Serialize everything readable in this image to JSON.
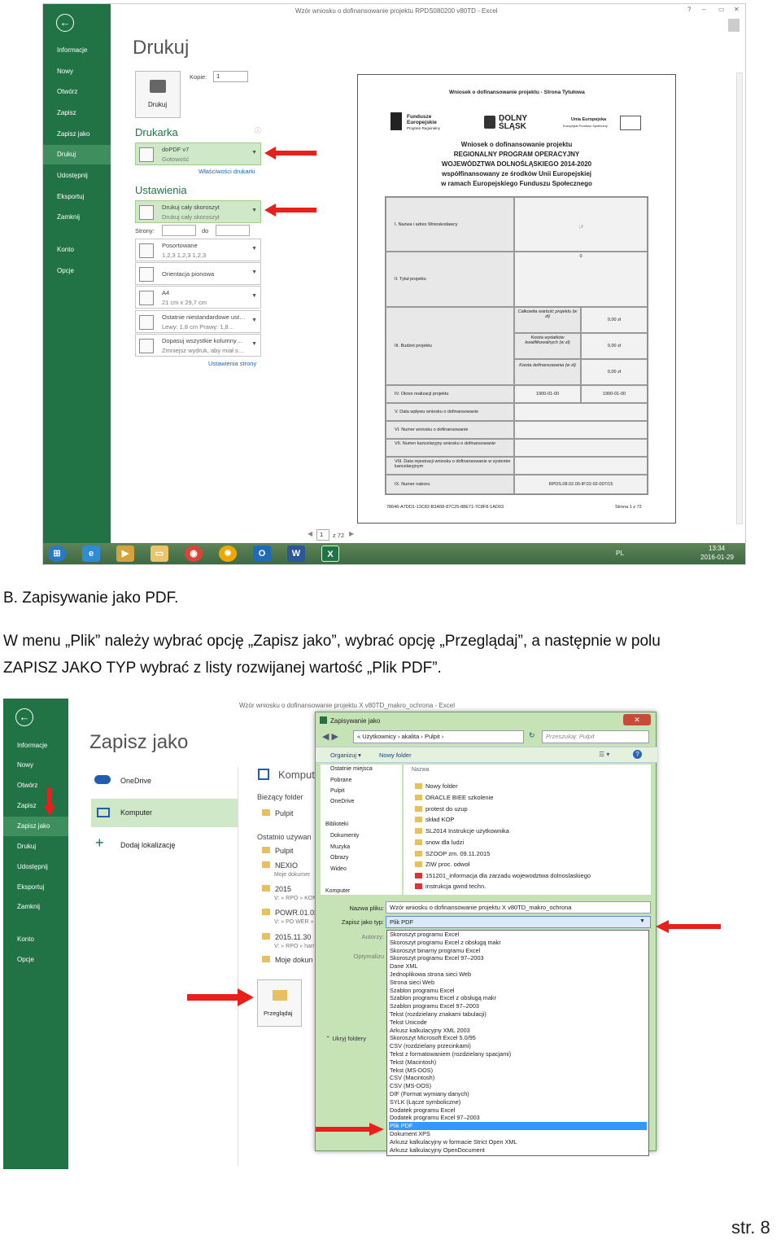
{
  "shot1": {
    "window_title": "Wzór wniosku o dofinansowanie projektu RPDS080200 v80TD - Excel",
    "window_controls": [
      "?",
      "–",
      "▭",
      "✕"
    ],
    "back_symbol": "←",
    "menu": [
      "Informacje",
      "Nowy",
      "Otwórz",
      "Zapisz",
      "Zapisz jako",
      "Drukuj",
      "Udostępnij",
      "Eksportuj",
      "Zamknij",
      "Konto",
      "Opcje"
    ],
    "heading": "Drukuj",
    "copies_label": "Kopie:",
    "copies_value": "1",
    "print_button": "Drukuj",
    "printer_section": "Drukarka",
    "printer_name": "doPDF v7",
    "printer_status": "Gotowość",
    "printer_properties": "Właściwości drukarki",
    "settings_section": "Ustawienia",
    "settings": [
      {
        "l1": "Drukuj cały skoroszyt",
        "l2": "Drukuj cały skoroszyt"
      },
      {
        "l1": "Posortowane",
        "l2": "1,2,3    1,2,3    1,2,3"
      },
      {
        "l1": "Orientacja pionowa",
        "l2": ""
      },
      {
        "l1": "A4",
        "l2": "21  cm x 29,7  cm"
      },
      {
        "l1": "Ostatnie niestandardowe ust…",
        "l2": "Lewy:  1,8  cm    Prawy:  1,8…"
      },
      {
        "l1": "Dopasuj wszystkie kolumny…",
        "l2": "Zmniejsz wydruk, aby miał s…"
      }
    ],
    "pages_label": "Strony:",
    "pages_to": "do",
    "page_setup_link": "Ustawienia strony",
    "pager_current": "1",
    "pager_total": "z 72",
    "taskbar_time": "13:34",
    "taskbar_date": "2016-01-29",
    "taskbar_lang": "PL",
    "preview": {
      "title": "Wniosek o dofinansowanie projektu - Strona Tytułowa",
      "logo_left_1": "Fundusze",
      "logo_left_2": "Europejskie",
      "logo_left_3": "Program Regionalny",
      "logo_mid_1": "DOLNY",
      "logo_mid_2": "ŚLĄSK",
      "logo_right_1": "Unia Europejska",
      "logo_right_2": "Europejski Fundusz Społeczny",
      "head_lines": [
        "Wniosek o dofinansowanie projektu",
        "REGIONALNY PROGRAM OPERACYJNY",
        "WOJEWÓDZTWA DOLNOŚLĄSKIEGO 2014-2020",
        "współfinansowany ze środków Unii Europejskiej",
        "w ramach Europejskiego Funduszu Społecznego"
      ],
      "row1_label": "I.    Nazwa i adres Wnioskodawcy",
      "row1_value": ";  /",
      "row2_label": "II. Tytuł projektu",
      "row2_value": "0",
      "row3_label": "III.   Budżet projektu",
      "budget": [
        {
          "k": "Całkowita wartość projektu (w zł)",
          "v": "0,00 zł"
        },
        {
          "k": "Kwota wydatków kwalifikowalnych (w zł)",
          "v": "0,00 zł"
        },
        {
          "k": "Kwota dofinansowania (w zł)",
          "v": "0,00 zł"
        }
      ],
      "row4_label": "IV. Okres realizacji projektu",
      "row4_from": "1900-01-00",
      "row4_to": "1900-01-00",
      "row5_label": "V. Data wpływu wniosku o dofinansowanie",
      "row6_label": "VI. Numer wniosku o dofinansowanie",
      "row7_label": "VII.   Numer kancelaryjny wniosku o dofinansowanie",
      "row8_label": "VIII. Data rejestracji wniosku o dofinansowanie w systemie kancelaryjnym",
      "row9_label": "IX. Numer naboru",
      "row9_value": "RPDS.08.02.00-IP.02-02-007/15",
      "footer_code": "78646-A7DD1-13C82-B3A58-87C25-88E71-7C8F8-1AD03",
      "footer_page": "Strona 1 z 72"
    }
  },
  "caption_b": "B. Zapisywanie jako PDF.",
  "instruction_line1": "W  menu  „Plik”  należy  wybrać  opcję  „Zapisz  jako”,  wybrać  opcję  „Przeglądaj”,  a  następnie  w  polu",
  "instruction_line2": "ZAPISZ JAKO TYP wybrać z listy rozwijanej wartość „Plik PDF”.",
  "shot2": {
    "window_title": "Wzór wniosku o dofinansowanie projektu X v80TD_makro_ochrona - Excel",
    "back_symbol": "←",
    "menu": [
      "Informacje",
      "Nowy",
      "Otwórz",
      "Zapisz",
      "Zapisz jako",
      "Drukuj",
      "Udostępnij",
      "Eksportuj",
      "Zamknij",
      "Konto",
      "Opcje"
    ],
    "heading": "Zapisz jako",
    "places": [
      "OneDrive",
      "Komputer",
      "Dodaj lokalizację"
    ],
    "right_heading": "Komput",
    "current_folder": "Bieżący folder",
    "current_folder_item": "Pulpit",
    "recent": "Ostatnio używan",
    "recent_items": [
      {
        "name": "Pulpit",
        "path": ""
      },
      {
        "name": "NEXIO",
        "path": "Moje dokumer"
      },
      {
        "name": "2015",
        "path": "V: » RPO » KON"
      },
      {
        "name": "POWR.01.02",
        "path": "V: » PO WER »"
      },
      {
        "name": "2015.11.30",
        "path": "V: » RPO » harr"
      },
      {
        "name": "Moje dokun",
        "path": ""
      }
    ],
    "browse_button": "Przeglądaj",
    "dialog": {
      "title": "Zapisywanie jako",
      "close": "✕",
      "breadcrumb": "«  Użytkownicy  ›  akalita  ›  Pulpit  ›",
      "search_placeholder": "Przeszukaj: Pulpit",
      "organize": "Organizuj ▾",
      "new_folder": "Nowy folder",
      "name_column": "Nazwa",
      "nav": [
        "Ostatnie miejsca",
        "Pobrane",
        "Pulpit",
        "OneDrive",
        "Biblioteki",
        "Dokumenty",
        "Muzyka",
        "Obrazy",
        "Wideo",
        "Komputer"
      ],
      "files": [
        "Nowy folder",
        "ORACLE BIEE szkolenie",
        "protest do uzup",
        "skład KOP",
        "SL2014 Instrukcje użytkownika",
        "snow dla ludzi",
        "SZOOP zm. 09.11.2015",
        "ZIW proc. odwoł",
        "151201_informacja dla zarzadu wojewodztwa dolnoslaskiego",
        "instrukcja gwnd techn."
      ],
      "filename_label": "Nazwa pliku:",
      "filename_value": "Wzór wniosku o dofinansowanie projektu X v80TD_makro_ochrona",
      "filetype_label": "Zapisz jako typ:",
      "filetype_value": "Plik PDF",
      "authors_label": "Autorzy:",
      "optimize_label": "Optymalizu",
      "hide_folders": "Ukryj foldery",
      "types": [
        "Skoroszyt programu Excel",
        "Skoroszyt programu Excel z obsługą makr",
        "Skoroszyt binarny programu Excel",
        "Skoroszyt programu Excel 97–2003",
        "Dane XML",
        "Jednoplikowa strona sieci Web",
        "Strona sieci Web",
        "Szablon programu Excel",
        "Szablon programu Excel z obsługą makr",
        "Szablon programu Excel 97–2003",
        "Tekst (rozdzielany znakami tabulacji)",
        "Tekst Unicode",
        "Arkusz kalkulacyjny XML 2003",
        "Skoroszyt Microsoft Excel 5.0/95",
        "CSV (rozdzielany przecinkami)",
        "Tekst z formatowaniem (rozdzielany spacjami)",
        "Tekst (Macintosh)",
        "Tekst (MS-DOS)",
        "CSV (Macintosh)",
        "CSV (MS-DOS)",
        "DIF (Format wymiany danych)",
        "SYLK (Łącze symboliczne)",
        "Dodatek programu Excel",
        "Dodatek programu Excel 97–2003",
        "Plik PDF",
        "Dokument XPS",
        "Arkusz kalkulacyjny w formacie Strict Open XML",
        "Arkusz kalkulacyjny OpenDocument"
      ],
      "selected_type_index": 24
    }
  },
  "page_number": "str. 8",
  "colors": {
    "excel_green": "#217346",
    "highlight": "#cfe8c7",
    "arrow_red": "#e8201c",
    "select_blue": "#3399ff"
  }
}
